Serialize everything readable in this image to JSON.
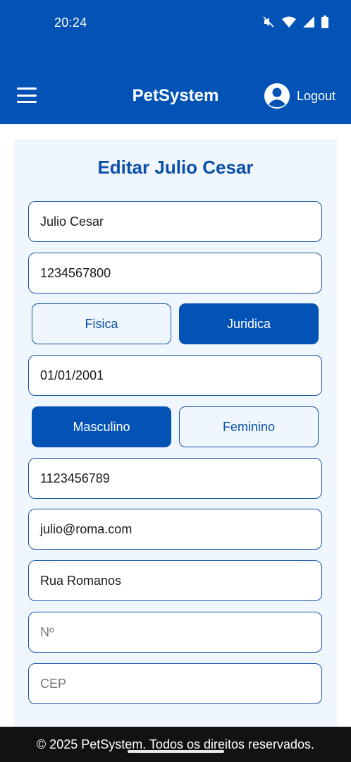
{
  "status_bar": {
    "time": "20:24",
    "icons": [
      "mute-icon",
      "wifi-icon",
      "signal-icon",
      "battery-icon"
    ]
  },
  "app_bar": {
    "title": "PetSystem",
    "logout_label": "Logout",
    "icons": [
      "menu-icon",
      "user-avatar-icon"
    ]
  },
  "form": {
    "title": "Editar Julio Cesar",
    "name": "Julio Cesar",
    "document": "1234567800",
    "person_type": {
      "options": [
        "Fisica",
        "Juridica"
      ],
      "selected": "Juridica"
    },
    "birth_date": "01/01/2001",
    "gender": {
      "options": [
        "Masculino",
        "Feminino"
      ],
      "selected": "Masculino"
    },
    "phone": "1123456789",
    "email": "julio@roma.com",
    "street": "Rua Romanos",
    "number_placeholder": "Nº",
    "cep_placeholder": "CEP"
  },
  "footer": {
    "text": "© 2025 PetSystem. Todos os direitos reservados."
  },
  "colors": {
    "primary": "#0352b5",
    "card_background": "#eff6fd",
    "field_border": "#1a56a8",
    "footer_background": "#121212"
  }
}
